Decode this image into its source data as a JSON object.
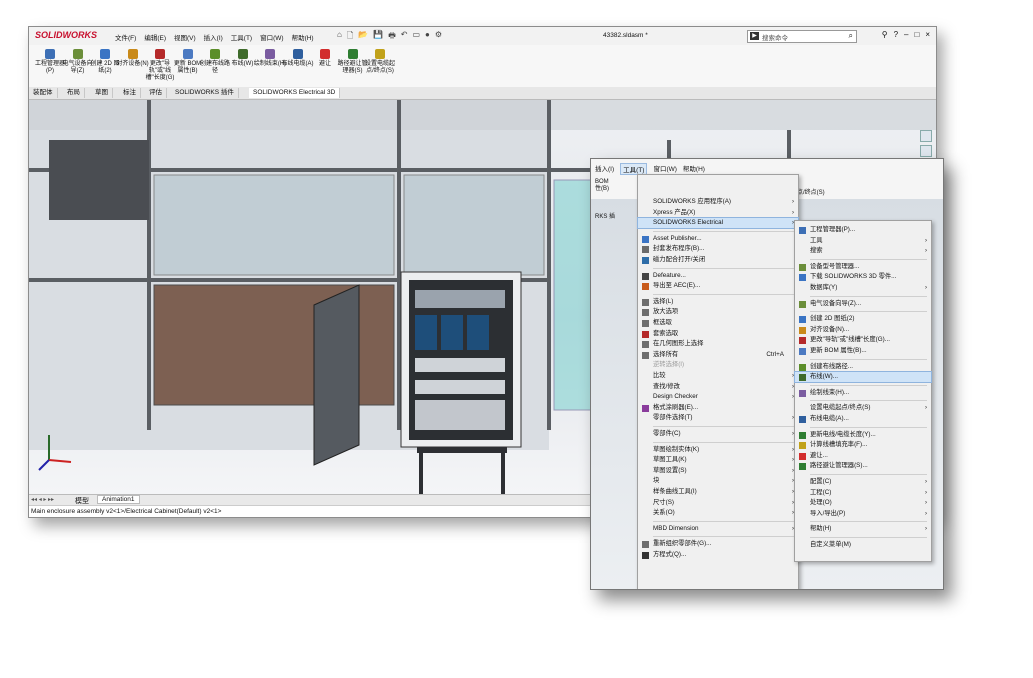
{
  "app": {
    "logo": "SOLIDWORKS",
    "document_title": "43382.sldasm *",
    "search_placeholder": "搜索命令",
    "menus": [
      "文件(F)",
      "编辑(E)",
      "视图(V)",
      "插入(I)",
      "工具(T)",
      "窗口(W)",
      "帮助(H)"
    ],
    "window_controls": [
      "?",
      "–",
      "□",
      "×"
    ]
  },
  "ribbon": {
    "buttons": [
      {
        "label": "工程管理器(P)",
        "color": "#3d6fb5"
      },
      {
        "label": "电气设备向导(Z)",
        "color": "#6b8e3a"
      },
      {
        "label": "创建 2D 图纸(2)",
        "color": "#3a74c4"
      },
      {
        "label": "对齐设备(N)",
        "color": "#c98a1a"
      },
      {
        "label": "更改\"导轨\"或\"线槽\"长度(G)",
        "color": "#b52a2a"
      },
      {
        "label": "更新 BOM 属性(B)",
        "color": "#4c7ac2"
      },
      {
        "label": "创建布线路径",
        "color": "#5c8e2a"
      },
      {
        "label": "布线(W)",
        "color": "#3f6b2b"
      },
      {
        "label": "绘制线束(H)",
        "color": "#7a5ca0"
      },
      {
        "label": "布线电缆(A)",
        "color": "#2f5f9e"
      },
      {
        "label": "避让",
        "color": "#d22d2d"
      },
      {
        "label": "路径避让管理器(S)",
        "color": "#2e7d32"
      },
      {
        "label": "设置电缆起点/终点(S)",
        "color": "#c1a21a"
      }
    ]
  },
  "tabs": [
    "装配体",
    "布局",
    "草图",
    "标注",
    "评估",
    "SOLIDWORKS 插件",
    "SOLIDWORKS Electrical 3D"
  ],
  "active_tab": "SOLIDWORKS Electrical 3D",
  "bottom_tabs": [
    "模型",
    "Animation1"
  ],
  "status_text": "Main enclosure assembly  v2<1>/Electrical Cabinet(Default)  v2<1>",
  "zoom_panel": {
    "menu": [
      "插入(I)",
      "工具(T)",
      "窗口(W)",
      "帮助(H)"
    ],
    "highlight_menu": "工具(T)",
    "partial_labels": [
      "BOM",
      "性(B)",
      "RKS 插",
      "起点/终点(S)"
    ],
    "tools_menu": [
      {
        "label": "SOLIDWORKS 应用程序(A)",
        "arrow": true
      },
      {
        "label": "Xpress 产品(X)",
        "arrow": true
      },
      {
        "label": "SOLIDWORKS Electrical",
        "arrow": true,
        "highlight": true
      },
      {
        "sep": true
      },
      {
        "label": "Asset Publisher...",
        "icon": "#3a74c4"
      },
      {
        "label": "封套发布程序(B)...",
        "icon": "#6a6a6a"
      },
      {
        "label": "磁力配合打开/关闭",
        "icon": "#2e6da8"
      },
      {
        "sep": true
      },
      {
        "label": "Defeature...",
        "icon": "#444"
      },
      {
        "label": "导出至 AEC(E)...",
        "icon": "#c85a1a"
      },
      {
        "sep": true
      },
      {
        "label": "选择(L)",
        "icon": "#6d6d6d"
      },
      {
        "label": "放大选项",
        "icon": "#6d6d6d"
      },
      {
        "label": "框选取",
        "icon": "#6d6d6d"
      },
      {
        "label": "套索选取",
        "icon": "#b52a2a"
      },
      {
        "label": "在几何图形上选择",
        "icon": "#6d6d6d"
      },
      {
        "label": "选择所有",
        "shortcut": "Ctrl+A",
        "icon": "#6d6d6d"
      },
      {
        "label": "padding-selection",
        "skip": true
      },
      {
        "label": "比较",
        "arrow": true
      },
      {
        "label": "查找/修改",
        "arrow": true
      },
      {
        "label": "Design Checker",
        "arrow": true
      },
      {
        "label": "格式涂刷器(E)...",
        "icon": "#8a3c9c"
      },
      {
        "label": "零部件选择(T)",
        "arrow": true
      },
      {
        "sep": true
      },
      {
        "label": "零部件(C)",
        "arrow": true
      },
      {
        "sep": true
      },
      {
        "label": "草图绘制实体(K)",
        "arrow": true
      },
      {
        "label": "草图工具(K)",
        "arrow": true
      },
      {
        "label": "草图设置(S)",
        "arrow": true
      },
      {
        "label": "块",
        "arrow": true
      },
      {
        "label": "样条曲线工具(I)",
        "arrow": true
      },
      {
        "label": "尺寸(S)",
        "arrow": true
      },
      {
        "label": "关系(O)",
        "arrow": true
      },
      {
        "sep": true
      },
      {
        "label": "MBD Dimension",
        "arrow": true
      },
      {
        "sep": true
      },
      {
        "label": "重新组织零部件(G)...",
        "icon": "#6d6d6d"
      },
      {
        "label": "方程式(Q)...",
        "icon": "#333"
      }
    ],
    "disabled_item": "逆转选择(I)",
    "electrical_menu": [
      {
        "label": "工程管理器(P)...",
        "icon": "#3d6fb5"
      },
      {
        "label": "工具",
        "arrow": true
      },
      {
        "label": "搜索",
        "arrow": true
      },
      {
        "sep": true
      },
      {
        "label": "设备型号管理器...",
        "icon": "#6b8e3a"
      },
      {
        "label": "下载 SOLIDWORKS 3D 零件...",
        "icon": "#3a74c4"
      },
      {
        "label": "数据库(Y)",
        "arrow": true
      },
      {
        "sep": true
      },
      {
        "label": "电气设备向导(Z)...",
        "icon": "#6b8e3a"
      },
      {
        "sep": true
      },
      {
        "label": "创建 2D 图纸(2)",
        "icon": "#3a74c4"
      },
      {
        "label": "对齐设备(N)...",
        "icon": "#c98a1a"
      },
      {
        "label": "更改\"导轨\"或\"线槽\"长度(G)...",
        "icon": "#b52a2a"
      },
      {
        "label": "更新 BOM 属性(B)...",
        "icon": "#4c7ac2"
      },
      {
        "sep": true
      },
      {
        "label": "创建布线路径...",
        "icon": "#5c8e2a"
      },
      {
        "label": "布线(W)...",
        "icon": "#3f6b2b",
        "highlight": true
      },
      {
        "sep": true
      },
      {
        "label": "绘制线束(H)...",
        "icon": "#7a5ca0"
      },
      {
        "sep": true
      },
      {
        "label": "设置电缆起点/终点(S)",
        "arrow": true
      },
      {
        "label": "布线电缆(A)...",
        "icon": "#2f5f9e"
      },
      {
        "sep": true
      },
      {
        "label": "更新电线/电缆长度(Y)...",
        "icon": "#2e7d32"
      },
      {
        "label": "计算线槽填充率(F)...",
        "icon": "#c1a21a"
      },
      {
        "label": "避让...",
        "icon": "#d22d2d"
      },
      {
        "label": "路径避让管理器(S)...",
        "icon": "#2e7d32"
      },
      {
        "sep": true
      },
      {
        "label": "配置(C)",
        "arrow": true
      },
      {
        "label": "工程(C)",
        "arrow": true
      },
      {
        "label": "处理(O)",
        "arrow": true
      },
      {
        "label": "导入/导出(P)",
        "arrow": true
      },
      {
        "sep": true
      },
      {
        "label": "帮助(H)",
        "arrow": true
      },
      {
        "sep": true
      },
      {
        "label": "自定义菜单(M)"
      }
    ]
  }
}
